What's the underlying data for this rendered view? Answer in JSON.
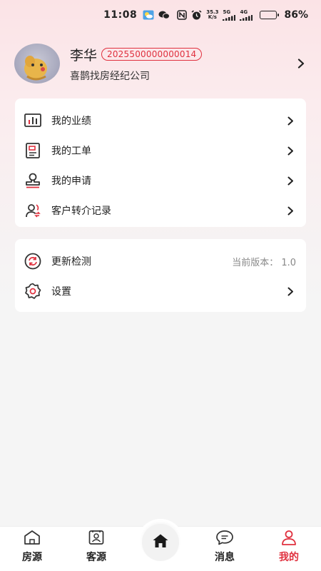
{
  "status_bar": {
    "time": "11:08",
    "net_speed_value": "35.3",
    "net_speed_unit": "K/s",
    "signal_5g": "5G",
    "signal_4g": "4G",
    "battery_percent": "86%",
    "battery_level": 0.86
  },
  "profile": {
    "name": "李华",
    "id": "2025500000000014",
    "company": "喜鹊找房经纪公司"
  },
  "menu": {
    "items": [
      {
        "label": "我的业绩",
        "icon": "chart-icon"
      },
      {
        "label": "我的工单",
        "icon": "work-order-icon"
      },
      {
        "label": "我的申请",
        "icon": "stamp-icon"
      },
      {
        "label": "客户转介记录",
        "icon": "user-transfer-icon"
      }
    ]
  },
  "settings": {
    "update_label": "更新检测",
    "version_text": "当前版本：  1.0",
    "settings_label": "设置"
  },
  "nav": {
    "houses": "房源",
    "clients": "客源",
    "messages": "消息",
    "mine": "我的"
  },
  "colors": {
    "accent": "#e0303e"
  }
}
